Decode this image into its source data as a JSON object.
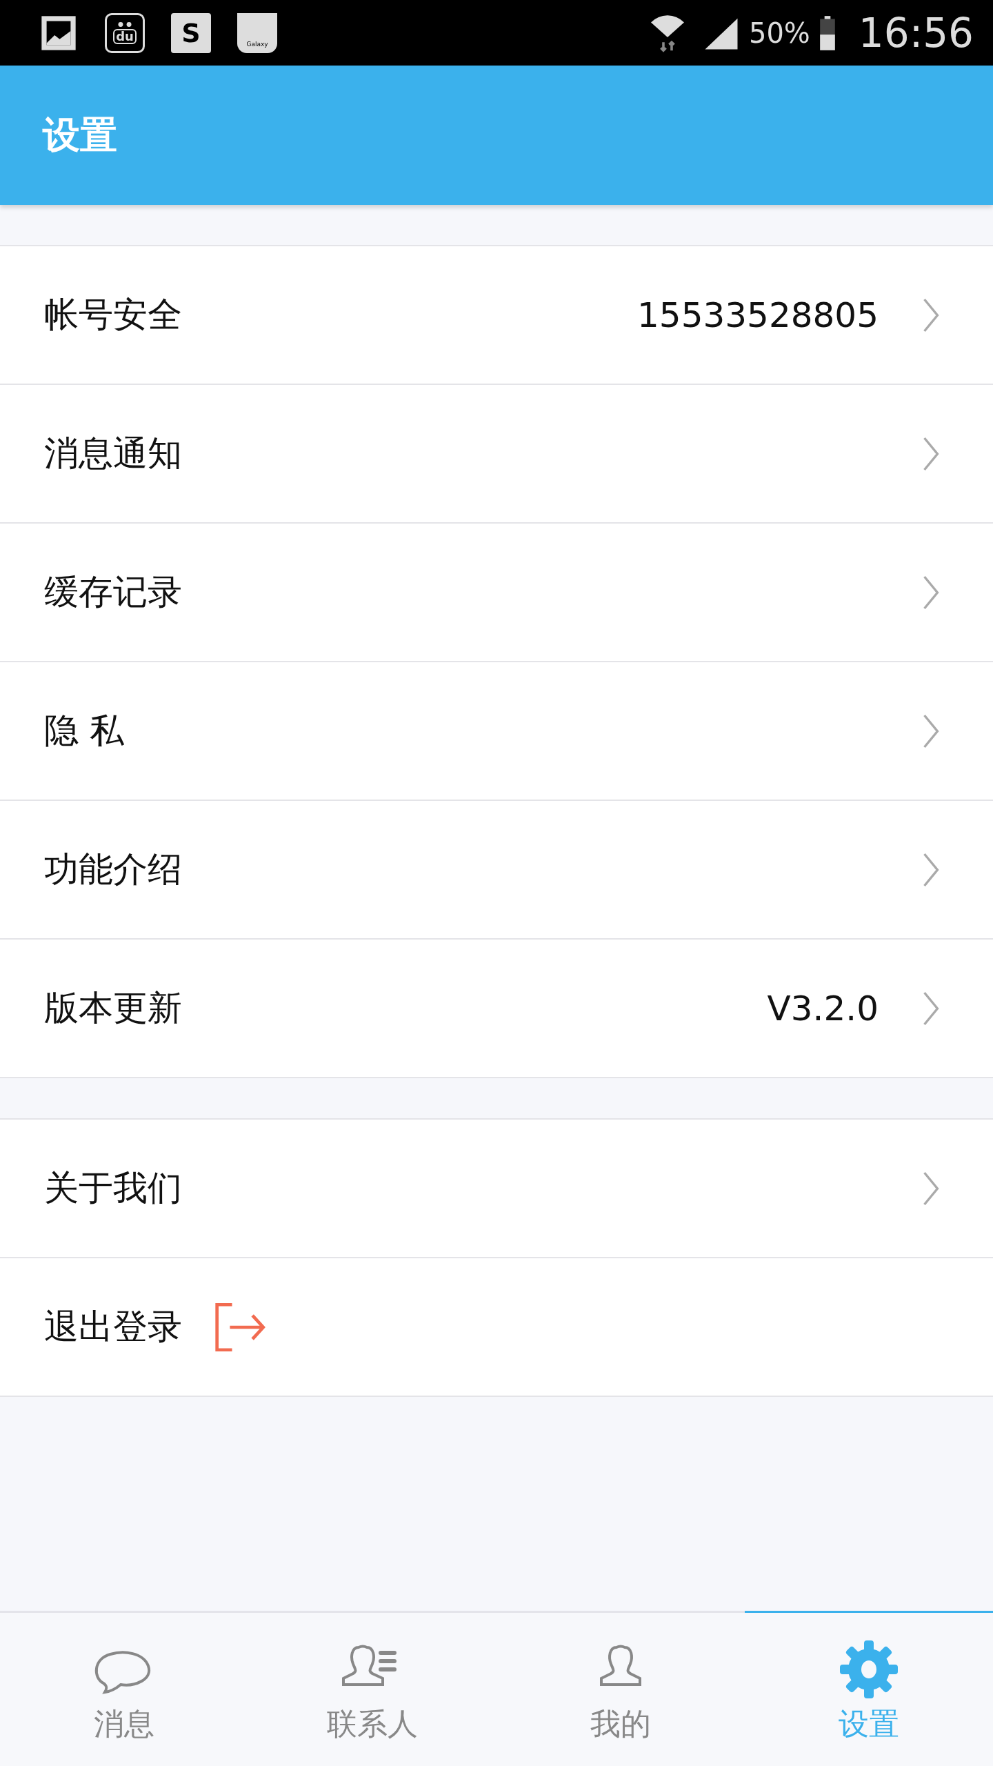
{
  "status_bar": {
    "notification_icons": [
      {
        "kind": "gallery"
      },
      {
        "kind": "paw",
        "text": "du"
      },
      {
        "kind": "s",
        "text": "S"
      },
      {
        "kind": "bag",
        "text": "Galaxy"
      }
    ],
    "battery_text": "50%",
    "time": "16:56"
  },
  "header": {
    "title": "设置"
  },
  "groups": [
    {
      "items": [
        {
          "label": "帐号安全",
          "value": "15533528805",
          "kind": "link"
        },
        {
          "label": "消息通知",
          "kind": "link"
        },
        {
          "label": "缓存记录",
          "kind": "link"
        },
        {
          "label": "隐 私",
          "kind": "link"
        },
        {
          "label": "功能介绍",
          "kind": "link"
        },
        {
          "label": "版本更新",
          "value": "V3.2.0",
          "kind": "link"
        }
      ]
    },
    {
      "items": [
        {
          "label": "关于我们",
          "kind": "link"
        },
        {
          "label": "退出登录",
          "kind": "logout"
        }
      ]
    }
  ],
  "tabs": [
    {
      "label": "消息",
      "kind": "chat",
      "selected": false
    },
    {
      "label": "联系人",
      "kind": "contacts",
      "selected": false
    },
    {
      "label": "我的",
      "kind": "person",
      "selected": false
    },
    {
      "label": "设置",
      "kind": "gear",
      "selected": true
    }
  ]
}
